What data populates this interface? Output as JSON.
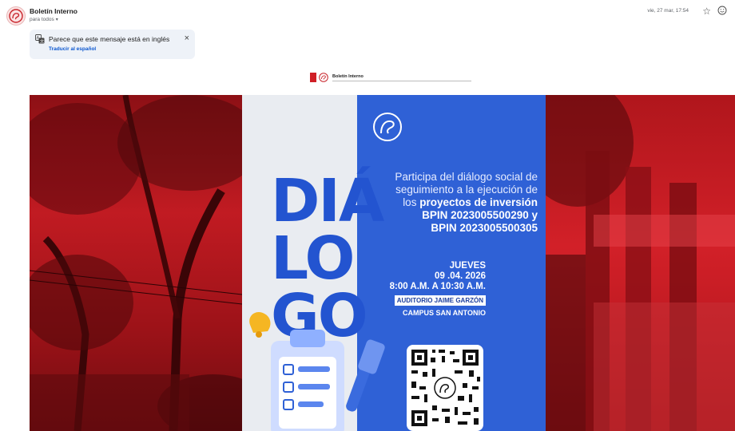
{
  "email": {
    "sender": "Boletín Interno",
    "recipient": "para todos",
    "date": "vie, 27 mar, 17:54",
    "star_icon": "star-icon",
    "emoji_icon": "emoji-icon"
  },
  "translate": {
    "message": "Parece que este mensaje está en inglés",
    "action": "Traducir al español",
    "close": "×"
  },
  "newsletter": {
    "title": "Boletín Interno"
  },
  "poster": {
    "big_word_1": "DIÁ",
    "big_word_2": "LO",
    "big_word_3": "GO",
    "intro": "Participa del diálogo social de seguimiento a la ejecución de",
    "intro_lead": "los ",
    "intro_bold_1": "proyectos de inversión",
    "intro_bold_2": "BPIN 2023005500290 y",
    "intro_bold_3": "BPIN 2023005500305",
    "day": "JUEVES",
    "date": "09 .04. 2026",
    "time": "8:00 A.M. A 10:30 A.M.",
    "place": "AUDITORIO JAIME GARZÓN",
    "campus": "CAMPUS SAN ANTONIO"
  },
  "colors": {
    "banner_red": "#c11b22",
    "poster_blue": "#2f61d6",
    "link_blue": "#0b57d0"
  }
}
